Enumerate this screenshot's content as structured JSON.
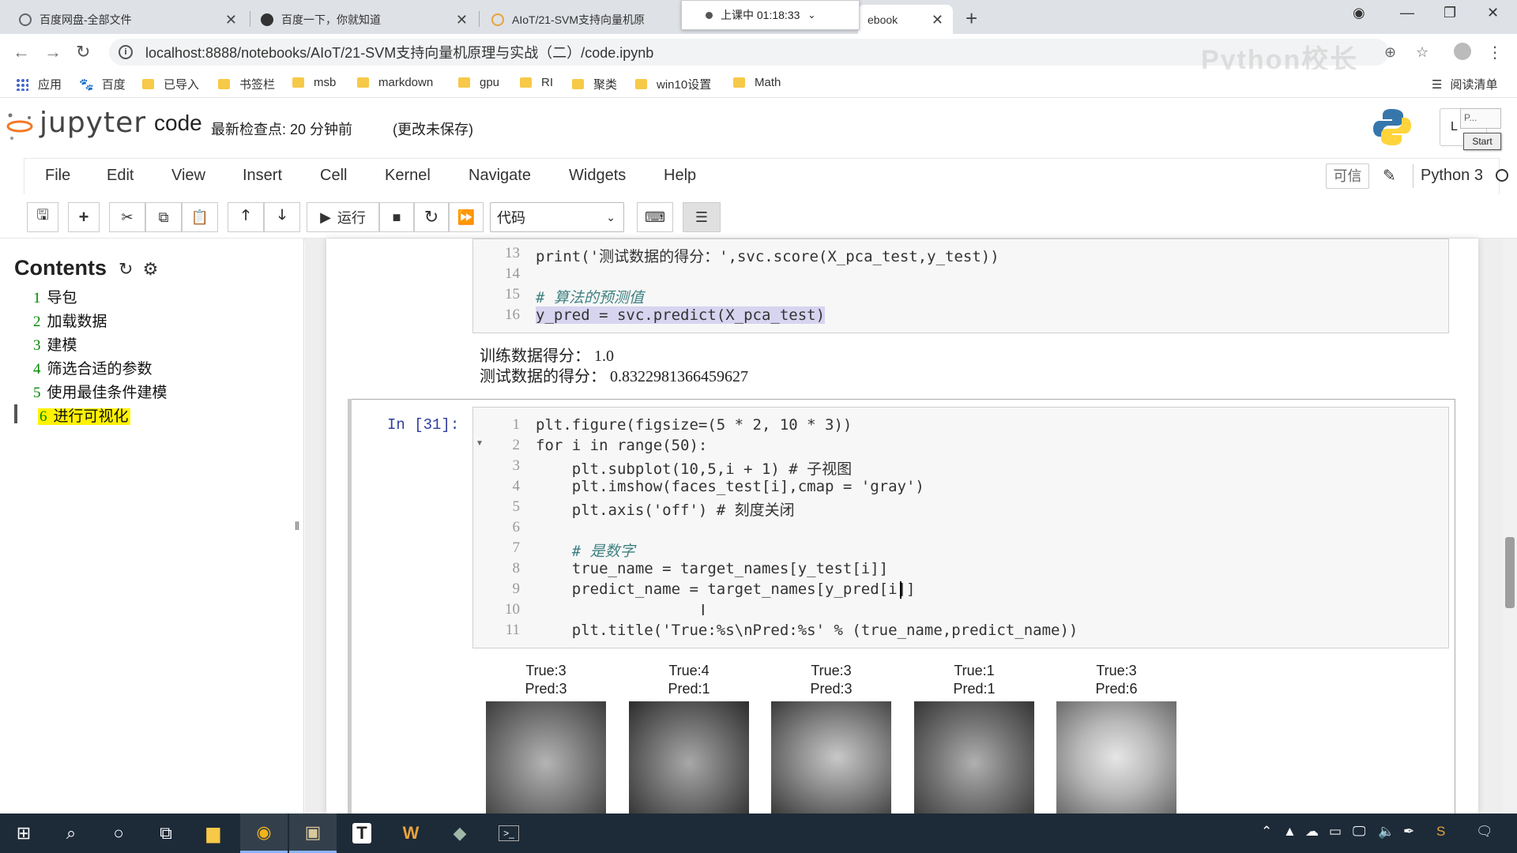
{
  "browser": {
    "tabs": [
      {
        "title": "百度网盘-全部文件"
      },
      {
        "title": "百度一下，你就知道"
      },
      {
        "title": "AIoT/21-SVM支持向量机原"
      },
      {
        "title": "ebook"
      }
    ],
    "recording": "上课中 01:18:33",
    "url": "localhost:8888/notebooks/AIoT/21-SVM支持向量机原理与实战（二）/code.ipynb",
    "watermark": "Python校长",
    "bookmarks": [
      "应用",
      "百度",
      "已导入",
      "书签栏",
      "msb",
      "markdown",
      "gpu",
      "RI",
      "聚类",
      "win10设置",
      "Math"
    ],
    "reading_list": "阅读清单"
  },
  "jupyter": {
    "logo": "jupyter",
    "notebook_name": "code",
    "checkpoint": "最新检查点: 20 分钟前",
    "unsaved": "(更改未保存)",
    "logout_short": "L",
    "mini_box": "P...",
    "start": "Start",
    "menu": [
      "File",
      "Edit",
      "View",
      "Insert",
      "Cell",
      "Kernel",
      "Navigate",
      "Widgets",
      "Help"
    ],
    "trusted": "可信",
    "kernel": "Python 3",
    "run_label": "运行",
    "cell_type": "代码"
  },
  "toc": {
    "title": "Contents",
    "items": [
      {
        "num": "1",
        "label": "导包"
      },
      {
        "num": "2",
        "label": "加载数据"
      },
      {
        "num": "3",
        "label": "建模"
      },
      {
        "num": "4",
        "label": "筛选合适的参数"
      },
      {
        "num": "5",
        "label": "使用最佳条件建模"
      },
      {
        "num": "6",
        "label": "进行可视化"
      }
    ]
  },
  "cell1": {
    "lines": [
      {
        "n": "13",
        "code": "print('测试数据的得分：',svc.score(X_pca_test,y_test))"
      },
      {
        "n": "14",
        "code": ""
      },
      {
        "n": "15",
        "code": "# 算法的预测值"
      },
      {
        "n": "16",
        "code": "y_pred = svc.predict(X_pca_test)"
      }
    ],
    "output": [
      "训练数据得分：  1.0",
      "测试数据的得分：  0.8322981366459627"
    ]
  },
  "cell2": {
    "prompt": "In  [31]:",
    "lines": [
      {
        "n": "1",
        "code": "plt.figure(figsize=(5 * 2, 10 * 3))"
      },
      {
        "n": "2",
        "code": "for i in range(50):"
      },
      {
        "n": "3",
        "code": "    plt.subplot(10,5,i + 1) # 子视图"
      },
      {
        "n": "4",
        "code": "    plt.imshow(faces_test[i],cmap = 'gray')"
      },
      {
        "n": "5",
        "code": "    plt.axis('off') # 刻度关闭"
      },
      {
        "n": "6",
        "code": ""
      },
      {
        "n": "7",
        "code": "    # 是数字"
      },
      {
        "n": "8",
        "code": "    true_name = target_names[y_test[i]]"
      },
      {
        "n": "9",
        "code": "    predict_name = target_names[y_pred[i]]"
      },
      {
        "n": "10",
        "code": ""
      },
      {
        "n": "11",
        "code": "    plt.title('True:%s\\nPred:%s' % (true_name,predict_name))"
      }
    ],
    "faces": [
      {
        "true": "True:3",
        "pred": "Pred:3"
      },
      {
        "true": "True:4",
        "pred": "Pred:1"
      },
      {
        "true": "True:3",
        "pred": "Pred:3"
      },
      {
        "true": "True:1",
        "pred": "Pred:1"
      },
      {
        "true": "True:3",
        "pred": "Pred:6"
      }
    ]
  },
  "colors": {
    "toc_highlight": "#fff200",
    "prompt": "#303f9f",
    "taskbar": "#1d2a38"
  }
}
